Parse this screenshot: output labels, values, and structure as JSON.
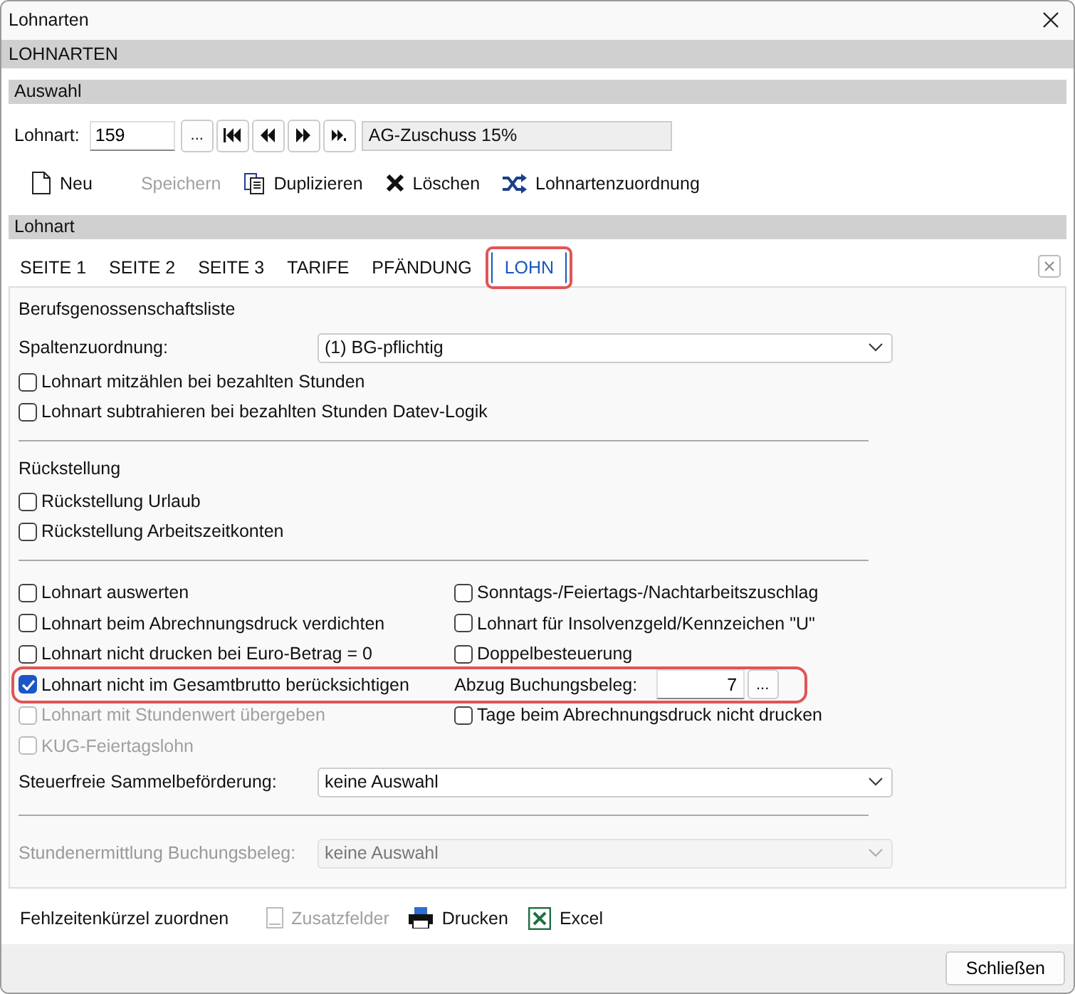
{
  "window": {
    "title": "Lohnarten"
  },
  "header": "LOHNARTEN",
  "auswahl": {
    "title": "Auswahl",
    "label": "Lohnart:",
    "value": "159",
    "browse": "...",
    "name": "AG-Zuschuss 15%"
  },
  "toolbar": [
    {
      "label": "Neu",
      "kind": "new",
      "disabled": false
    },
    {
      "label": "Speichern",
      "kind": "plain",
      "disabled": true
    },
    {
      "label": "Duplizieren",
      "kind": "copy",
      "disabled": false
    },
    {
      "label": "Löschen",
      "kind": "delete",
      "disabled": false
    },
    {
      "label": "Lohnartenzuordnung",
      "kind": "shuffle",
      "disabled": false
    }
  ],
  "section": "Lohnart",
  "tabs": [
    {
      "label": "SEITE 1",
      "selected": false,
      "highlighted": false
    },
    {
      "label": "SEITE 2",
      "selected": false,
      "highlighted": false
    },
    {
      "label": "SEITE 3",
      "selected": false,
      "highlighted": false
    },
    {
      "label": "TARIFE",
      "selected": false,
      "highlighted": false
    },
    {
      "label": "PFÄNDUNG",
      "selected": false,
      "highlighted": false
    },
    {
      "label": "LOHN",
      "selected": true,
      "highlighted": true
    }
  ],
  "bg": {
    "title": "Berufsgenossenschaftsliste",
    "select_label": "Spaltenzuordnung:",
    "select_value": "(1) BG-pflichtig",
    "checks": [
      {
        "label": "Lohnart mitzählen bei bezahlten Stunden",
        "checked": false,
        "disabled": false
      },
      {
        "label": "Lohnart subtrahieren bei bezahlten Stunden Datev-Logik",
        "checked": false,
        "disabled": false
      }
    ]
  },
  "rueck": {
    "title": "Rückstellung",
    "checks": [
      {
        "label": "Rückstellung Urlaub",
        "checked": false,
        "disabled": false
      },
      {
        "label": "Rückstellung Arbeitszeitkonten",
        "checked": false,
        "disabled": false
      }
    ]
  },
  "options": [
    {
      "highlighted": false,
      "left": {
        "label": "Lohnart auswerten",
        "checked": false,
        "disabled": false
      },
      "right": {
        "kind": "check",
        "label": "Sonntags-/Feiertags-/Nachtarbeitszuschlag",
        "checked": false,
        "disabled": false
      }
    },
    {
      "highlighted": false,
      "left": {
        "label": "Lohnart beim Abrechnungsdruck verdichten",
        "checked": false,
        "disabled": false
      },
      "right": {
        "kind": "check",
        "label": "Lohnart für Insolvenzgeld/Kennzeichen \"U\"",
        "checked": false,
        "disabled": false
      }
    },
    {
      "highlighted": false,
      "left": {
        "label": "Lohnart nicht drucken bei Euro-Betrag = 0",
        "checked": false,
        "disabled": false
      },
      "right": {
        "kind": "check",
        "label": "Doppelbesteuerung",
        "checked": false,
        "disabled": false
      }
    },
    {
      "highlighted": true,
      "left": {
        "label": "Lohnart nicht im Gesamtbrutto berücksichtigen",
        "checked": true,
        "disabled": false
      },
      "right": {
        "kind": "field",
        "label": "Abzug Buchungsbeleg:",
        "value": "7",
        "browse": "..."
      }
    },
    {
      "highlighted": false,
      "left": {
        "label": "Lohnart mit Stundenwert übergeben",
        "checked": false,
        "disabled": true
      },
      "right": {
        "kind": "check",
        "label": "Tage beim Abrechnungsdruck nicht drucken",
        "checked": false,
        "disabled": false
      }
    },
    {
      "highlighted": false,
      "left": {
        "label": "KUG-Feiertagslohn",
        "checked": false,
        "disabled": true
      }
    }
  ],
  "selects": [
    {
      "label": "Steuerfreie Sammelbeförderung:",
      "value": "keine Auswahl",
      "disabled": false,
      "rule_before": false
    },
    {
      "label": "Stundenermittlung Buchungsbeleg:",
      "value": "keine Auswahl",
      "disabled": true,
      "rule_before": true
    }
  ],
  "bottom_toolbar": [
    {
      "label": "Fehlzeitenkürzel zuordnen",
      "kind": "plain",
      "disabled": false
    },
    {
      "label": "Zusatzfelder",
      "kind": "fields",
      "disabled": true
    },
    {
      "label": "Drucken",
      "kind": "print",
      "disabled": false
    },
    {
      "label": "Excel",
      "kind": "excel",
      "disabled": false
    }
  ],
  "close_button": "Schließen"
}
